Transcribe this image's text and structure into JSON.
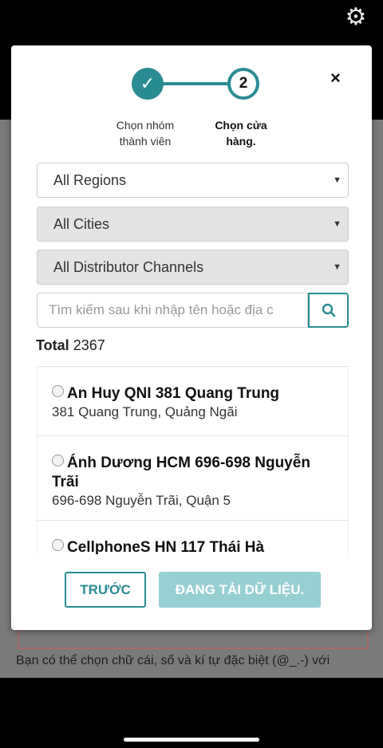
{
  "background": {
    "hint_line1": "Bạn có thể chọn chữ cái, số và kí tự đặc biệt (@_.-) với",
    "hint_line2": ""
  },
  "modal": {
    "close_symbol": "×",
    "steps": [
      {
        "marker": "✓",
        "label_line1": "Chọn nhóm",
        "label_line2": "thành viên"
      },
      {
        "marker": "2",
        "label_line1": "Chọn cửa",
        "label_line2": "hàng."
      }
    ],
    "filters": {
      "regions": "All Regions",
      "cities": "All Cities",
      "channels": "All Distributor Channels"
    },
    "search": {
      "placeholder": "Tìm kiếm sau khi nhập tên hoặc địa c"
    },
    "total_label": "Total",
    "total_value": "2367",
    "stores": [
      {
        "name": "An Huy QNI 381 Quang Trung",
        "address": "381 Quang Trung, Quảng Ngãi"
      },
      {
        "name_line1": "Ánh Dương HCM 696-698 Nguyễn",
        "name_line2": "Trãi",
        "address": "696-698 Nguyễn Trãi, Quận 5"
      },
      {
        "name": "CellphoneS HN 117 Thái Hà"
      }
    ],
    "buttons": {
      "prev": "TRƯỚC",
      "loading": "ĐANG TẢI DỮ LIỆU."
    }
  },
  "colors": {
    "accent": "#2a8c93",
    "accent_disabled": "#97cfd3"
  }
}
